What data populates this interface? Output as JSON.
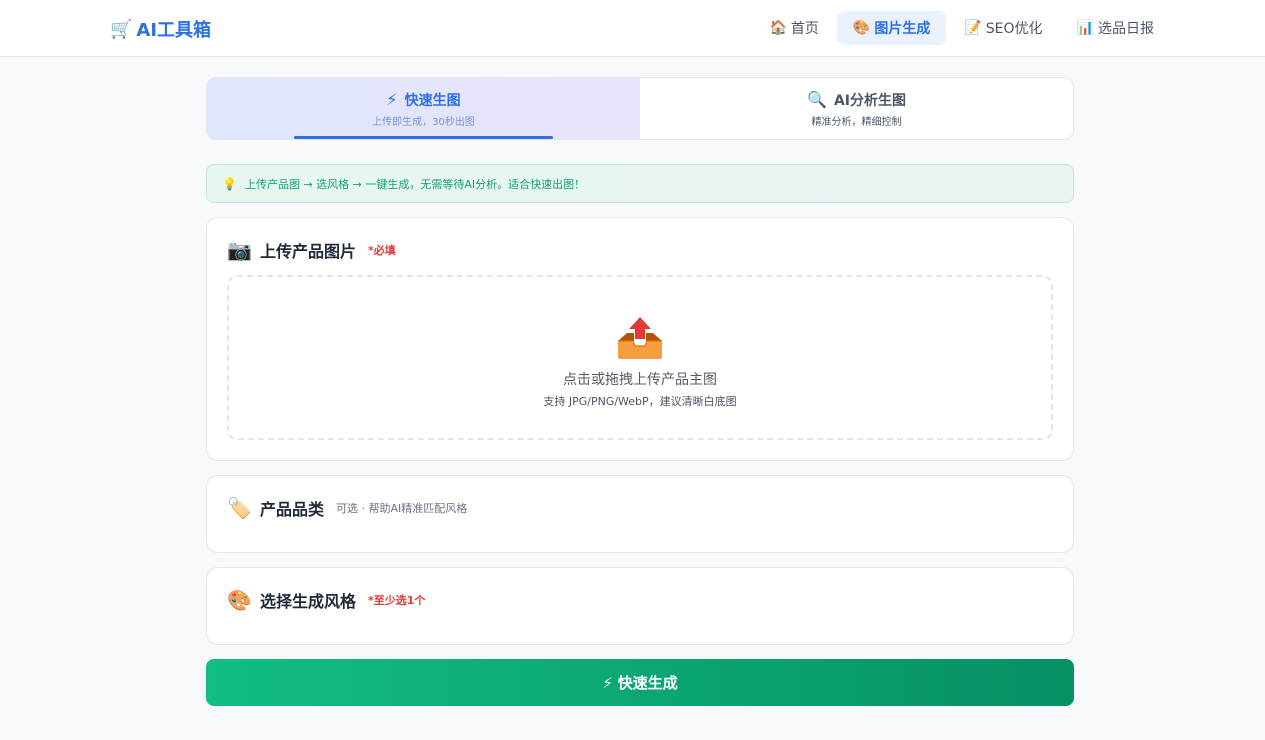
{
  "header": {
    "brand": {
      "icon": "cart-icon",
      "label": "AI工具箱",
      "color": "#2f6fe4"
    },
    "nav": [
      {
        "icon": "house-icon",
        "glyph": "🏠",
        "label": "首页",
        "active": false
      },
      {
        "icon": "palette-icon",
        "glyph": "🎨",
        "label": "图片生成",
        "active": true
      },
      {
        "icon": "memo-icon",
        "glyph": "📝",
        "label": "SEO优化",
        "active": false
      },
      {
        "icon": "bar-chart-icon",
        "glyph": "📊",
        "label": "选品日报",
        "active": false
      }
    ]
  },
  "mode_tabs": [
    {
      "icon": "lightning-icon",
      "glyph": "⚡",
      "title": "快速生图",
      "subtitle": "上传即生成，30秒出图",
      "active": true
    },
    {
      "icon": "magnifier-icon",
      "glyph": "🔍",
      "title": "AI分析生图",
      "subtitle": "精准分析，精细控制",
      "active": false
    }
  ],
  "tip": {
    "icon": "lightbulb-icon",
    "glyph": "💡",
    "text": "上传产品图 → 选风格 → 一键生成，无需等待AI分析。适合快速出图！"
  },
  "upload_card": {
    "icon": "camera-icon",
    "glyph": "📷",
    "title": "上传产品图片",
    "required": "*必填",
    "dropzone": {
      "icon": "outbox-tray-icon",
      "main_text": "点击或拖拽上传产品主图",
      "sub_text": "支持 JPG/PNG/WebP，建议清晰白底图"
    }
  },
  "category_card": {
    "icon": "tag-icon",
    "glyph": "🏷️",
    "title": "产品品类",
    "hint": "可选 · 帮助AI精准匹配风格"
  },
  "style_card": {
    "icon": "palette-icon",
    "glyph": "🎨",
    "title": "选择生成风格",
    "required": "*至少选1个"
  },
  "generate_button": {
    "icon": "lightning-icon",
    "glyph": "⚡",
    "label": "快速生成",
    "gradient": [
      "#13bd85",
      "#059066"
    ]
  }
}
